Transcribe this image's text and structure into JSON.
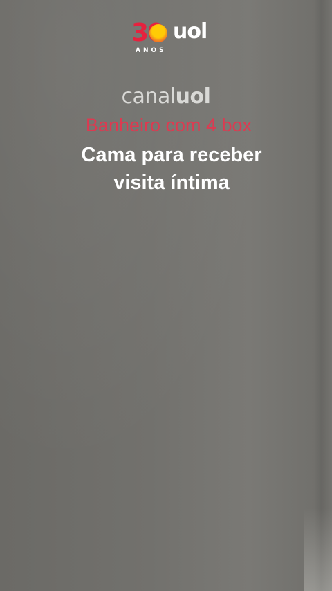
{
  "logo": {
    "number": "30",
    "brand": "uol",
    "subtitle": "ANOS",
    "colors": {
      "red": "#e7213e",
      "yellow": "#ffcb05",
      "orange": "#f59a1a"
    }
  },
  "channel": {
    "part1": "canal",
    "part2": "uol"
  },
  "captions": {
    "highlight": "Banheiro com 4 box",
    "line1": "Cama para receber",
    "line2": "visita íntima",
    "highlight_color": "#e5364f"
  }
}
